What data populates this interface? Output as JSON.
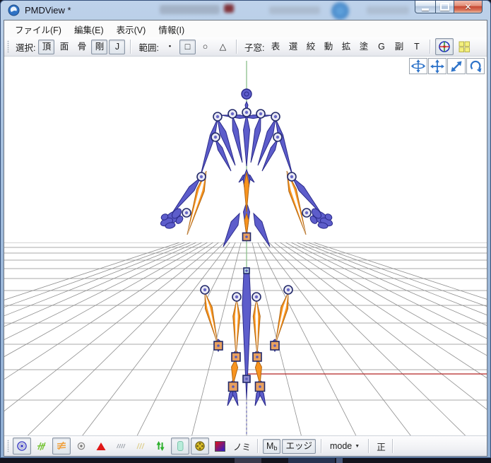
{
  "window": {
    "title": "PMDView *"
  },
  "menu_bar": {
    "items": [
      "ファイル(F)",
      "編集(E)",
      "表示(V)",
      "情報(I)"
    ]
  },
  "toolbar": {
    "select": {
      "label": "選択:",
      "buttons": [
        {
          "label": "頂",
          "pressed": true
        },
        {
          "label": "面",
          "pressed": false
        },
        {
          "label": "骨",
          "pressed": false
        },
        {
          "label": "剛",
          "pressed": true
        },
        {
          "label": "J",
          "pressed": true
        }
      ]
    },
    "range": {
      "label": "範囲:",
      "dot": "・",
      "buttons": [
        {
          "label": "□",
          "pressed": true
        },
        {
          "label": "○",
          "pressed": false
        },
        {
          "label": "△",
          "pressed": false
        }
      ]
    },
    "subwindow": {
      "label": "子窓:",
      "buttons": [
        {
          "label": "表"
        },
        {
          "label": "選"
        },
        {
          "label": "絞"
        },
        {
          "label": "動"
        },
        {
          "label": "拡"
        },
        {
          "label": "塗"
        },
        {
          "label": "G"
        },
        {
          "label": "副"
        },
        {
          "label": "T"
        }
      ]
    },
    "icon_buttons": [
      {
        "name": "local-axis-icon",
        "pressed": true
      },
      {
        "name": "quad-view-icon",
        "pressed": false
      }
    ]
  },
  "viewport": {
    "nav_buttons": [
      {
        "name": "orbit-view-icon"
      },
      {
        "name": "pan-view-icon"
      },
      {
        "name": "zoom-view-icon"
      },
      {
        "name": "rotate-view-icon"
      }
    ],
    "colors": {
      "background": "#ffffff",
      "bone_blue": "#5d5dcb",
      "bone_blue_edge": "#2a2a8a",
      "bone_orange": "#f8941f",
      "bone_orange_edge": "#b06512",
      "joint_fill": "#e8e8f4",
      "joint_edge": "#232a6a",
      "square_fill": "#e8a060",
      "grid_line": "#a8a8a8",
      "grid_diagonal": "#8e8e8e",
      "axis_green": "#8cc08c",
      "axis_red": "#b52424",
      "axis_below": "#4a4aa0"
    }
  },
  "bottom_toolbar": {
    "icons": [
      {
        "name": "bone-marker-icon",
        "pressed": true
      },
      {
        "name": "green-hatch-icon",
        "pressed": false
      },
      {
        "name": "orange-hatch-icon",
        "pressed": true
      },
      {
        "name": "gray-marker-icon",
        "pressed": false
      },
      {
        "name": "red-triangle-icon",
        "pressed": false
      },
      {
        "name": "gray-hatch-icon",
        "pressed": false
      },
      {
        "name": "yellow-hatch-icon",
        "pressed": false
      },
      {
        "name": "green-arrows-icon",
        "pressed": false
      },
      {
        "name": "cyan-box-icon",
        "pressed": true
      },
      {
        "name": "gear-icon",
        "pressed": true
      }
    ],
    "swatch_name": "color-swatch-icon",
    "nomi_label": "ノミ",
    "mb_button": {
      "main": "M",
      "sub": "b"
    },
    "edge_button_label": "エッジ",
    "mode_button_label": "mode",
    "front_label": "正"
  }
}
